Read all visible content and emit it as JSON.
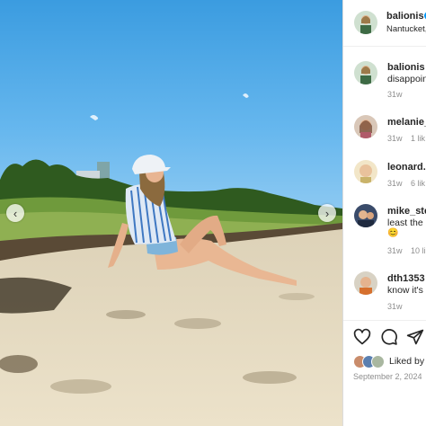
{
  "post": {
    "username": "balionis",
    "location": "Nantucket,"
  },
  "caption": {
    "username": "balionis",
    "text": "disappoin",
    "age": "31w"
  },
  "comments": [
    {
      "username": "melanie_",
      "lines": [
        ""
      ],
      "age": "31w",
      "likes": "1 lik"
    },
    {
      "username": "leonard.",
      "lines": [
        ""
      ],
      "age": "31w",
      "likes": "6 lik"
    },
    {
      "username": "mike_ste",
      "lines": [
        "least the",
        "😊"
      ],
      "age": "31w",
      "likes": "10 li"
    },
    {
      "username": "dth1353",
      "lines": [
        "know it's"
      ],
      "age": "31w",
      "likes": ""
    }
  ],
  "footer": {
    "liked_by": "Liked by",
    "date": "September 2, 2024"
  },
  "icons": {
    "like": "heart-icon",
    "comment": "comment-icon",
    "share": "share-icon",
    "prev": "chevron-left-icon",
    "next": "chevron-right-icon",
    "verified": "verified-badge-icon"
  },
  "colors": {
    "sky": "#3f9fe0",
    "sand": "#e6dcc4",
    "grass": "#6f9a3c",
    "verified": "#0095f6",
    "meta": "#8e8e8e"
  },
  "carousel": {
    "prev_glyph": "‹",
    "next_glyph": "›"
  }
}
